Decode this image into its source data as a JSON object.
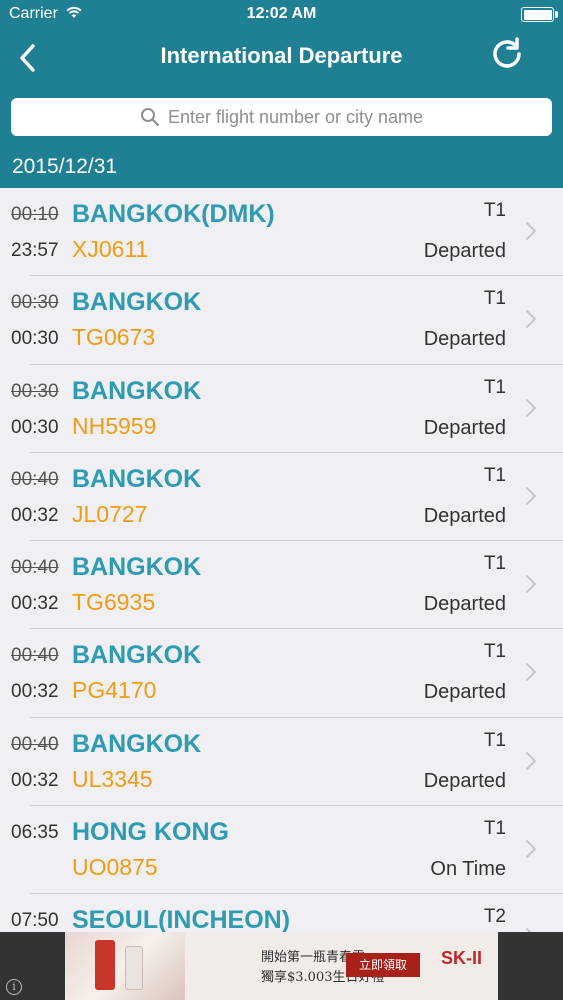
{
  "status_bar": {
    "carrier": "Carrier",
    "time": "12:02 AM"
  },
  "nav": {
    "title": "International Departure",
    "back_icon": "chevron-left-icon",
    "refresh_icon": "refresh-icon"
  },
  "search": {
    "placeholder": "Enter flight number or city name"
  },
  "date": "2015/12/31",
  "colors": {
    "header": "#1f7f93",
    "city": "#2e9bb2",
    "flight": "#f39c12"
  },
  "flights": [
    {
      "scheduled": "00:10",
      "actual": "23:57",
      "city": "BANGKOK(DMK)",
      "flight": "XJ0611",
      "terminal": "T1",
      "status": "Departed"
    },
    {
      "scheduled": "00:30",
      "actual": "00:30",
      "city": "BANGKOK",
      "flight": "TG0673",
      "terminal": "T1",
      "status": "Departed"
    },
    {
      "scheduled": "00:30",
      "actual": "00:30",
      "city": "BANGKOK",
      "flight": "NH5959",
      "terminal": "T1",
      "status": "Departed"
    },
    {
      "scheduled": "00:40",
      "actual": "00:32",
      "city": "BANGKOK",
      "flight": "JL0727",
      "terminal": "T1",
      "status": "Departed"
    },
    {
      "scheduled": "00:40",
      "actual": "00:32",
      "city": "BANGKOK",
      "flight": "TG6935",
      "terminal": "T1",
      "status": "Departed"
    },
    {
      "scheduled": "00:40",
      "actual": "00:32",
      "city": "BANGKOK",
      "flight": "PG4170",
      "terminal": "T1",
      "status": "Departed"
    },
    {
      "scheduled": "00:40",
      "actual": "00:32",
      "city": "BANGKOK",
      "flight": "UL3345",
      "terminal": "T1",
      "status": "Departed"
    },
    {
      "scheduled": "06:35",
      "actual": "",
      "city": "HONG KONG",
      "flight": "UO0875",
      "terminal": "T1",
      "status": "On Time"
    },
    {
      "scheduled": "07:50",
      "actual": "",
      "city": "SEOUL(INCHEON)",
      "flight": "",
      "terminal": "T2",
      "status": ""
    }
  ],
  "ad": {
    "line1": "開始第一瓶青春露",
    "line2": "獨享$3.003生日好禮",
    "cta": "立即領取",
    "brand": "SK-II",
    "info": "i"
  }
}
